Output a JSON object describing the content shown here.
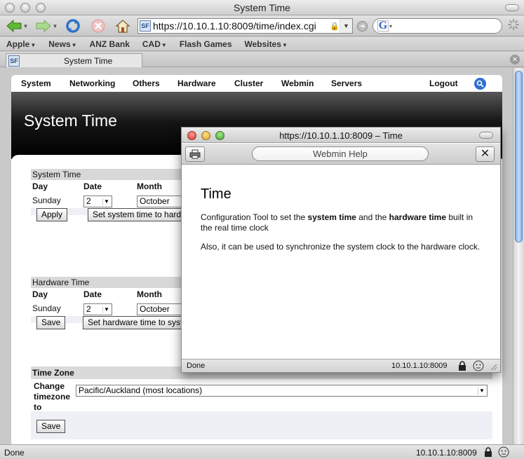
{
  "browser": {
    "window_title": "System Time",
    "url": "https://10.10.1.10:8009/time/index.cgi",
    "bookmarks": [
      "Apple",
      "News",
      "ANZ Bank",
      "CAD",
      "Flash Games",
      "Websites"
    ],
    "tab_title": "System Time",
    "status": "Done",
    "status_host": "10.10.1.10:8009"
  },
  "webmin": {
    "menu": [
      "System",
      "Networking",
      "Others",
      "Hardware",
      "Cluster",
      "Webmin",
      "Servers"
    ],
    "logout": "Logout",
    "page_title": "System Time"
  },
  "system_time": {
    "heading": "System Time",
    "columns": [
      "Day",
      "Date",
      "Month"
    ],
    "day": "Sunday",
    "date": "2",
    "month": "October",
    "apply_label": "Apply",
    "set_label": "Set system time to hardware time"
  },
  "hardware_time": {
    "heading": "Hardware Time",
    "columns": [
      "Day",
      "Date",
      "Month"
    ],
    "day": "Sunday",
    "date": "2",
    "month": "October",
    "save_label": "Save",
    "set_label": "Set hardware time to system time"
  },
  "time_zone": {
    "heading": "Time Zone",
    "label_lines": [
      "Change",
      "timezone",
      "to"
    ],
    "value": "Pacific/Auckland (most locations)",
    "save_label": "Save"
  },
  "help_popup": {
    "window_title": "https://10.10.1.10:8009 – Time",
    "field": "Webmin Help",
    "heading": "Time",
    "p1_a": "Configuration Tool to set the ",
    "p1_b": "system time",
    "p1_c": " and the ",
    "p1_d": "hardware time",
    "p1_e": " built in the real time clock",
    "p2": "Also, it can be used to synchronize the system clock to the hardware clock.",
    "status": "Done",
    "status_host": "10.10.1.10:8009"
  },
  "colors": {
    "traffic_close": "#e2433b",
    "traffic_min": "#e8b32c",
    "traffic_max": "#4fb13b",
    "banner": "#000000",
    "section_head": "#d8d8d8",
    "section_body": "#eef0f6"
  },
  "icons": {
    "back": "arrow-left-icon",
    "forward": "arrow-right-icon",
    "reload": "reload-icon",
    "stop": "stop-icon",
    "home": "home-icon",
    "search": "magnifier-icon",
    "print": "printer-icon",
    "lock": "lock-icon"
  }
}
